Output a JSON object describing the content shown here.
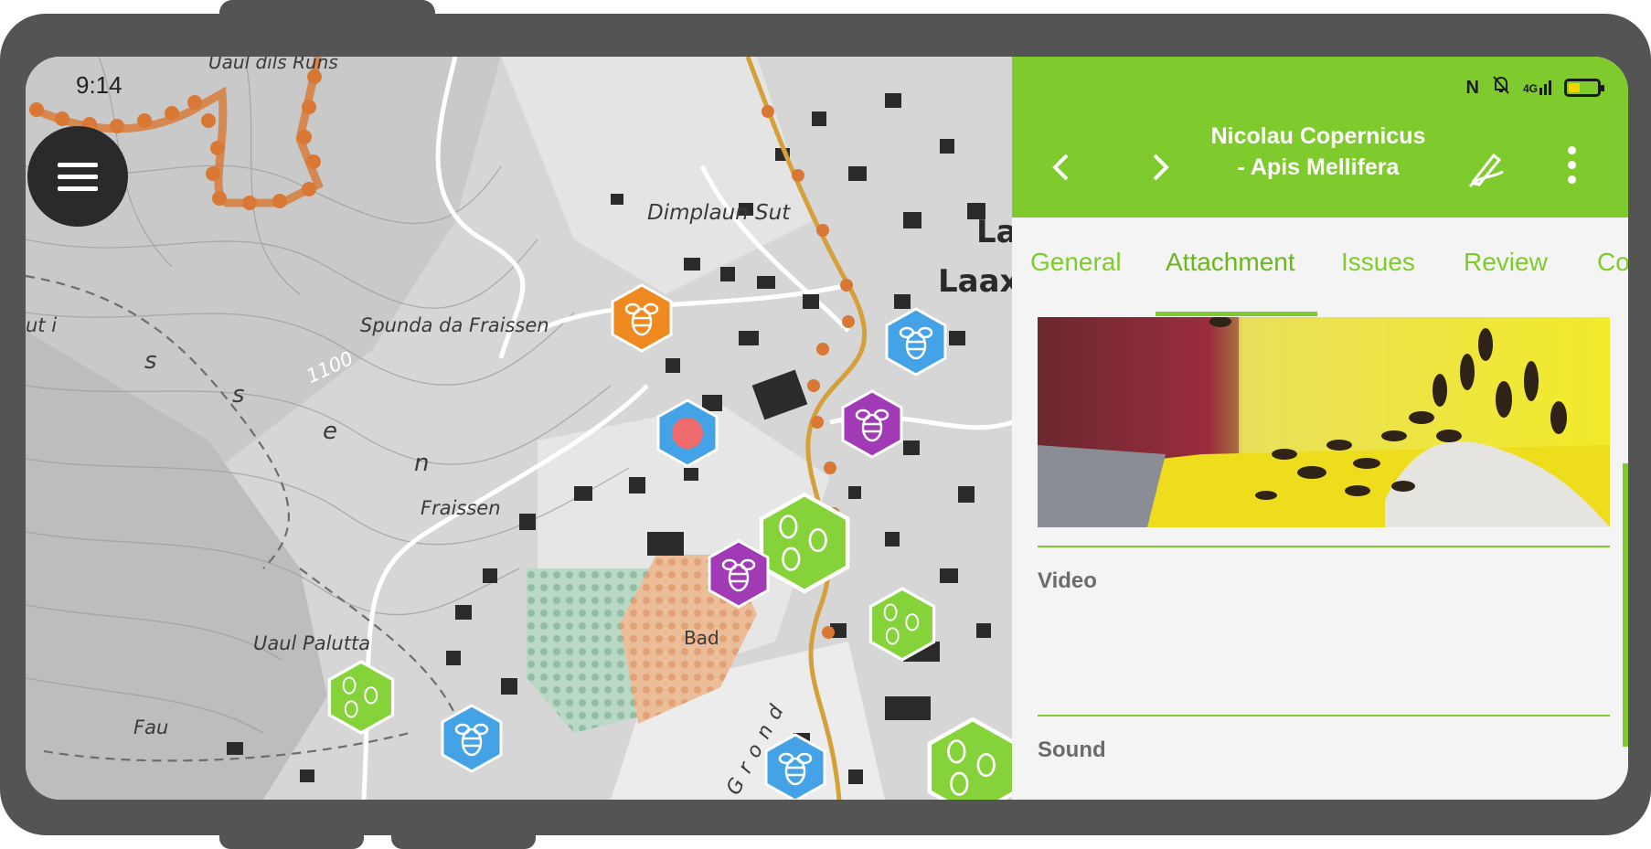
{
  "status_bar": {
    "time": "9:14",
    "network_label": "4G",
    "icons": [
      "nfc-icon",
      "bell-off-icon",
      "signal-icon",
      "battery-icon"
    ]
  },
  "map": {
    "labels": [
      {
        "id": "uaul-dils-runs",
        "text": "Uaul dils Runs"
      },
      {
        "id": "dimplaun-sut",
        "text": "Dimplaun Sut"
      },
      {
        "id": "spunda-da-fraissen",
        "text": "Spunda da Fraissen"
      },
      {
        "id": "laax",
        "text": "Laax"
      },
      {
        "id": "la",
        "text": "La"
      },
      {
        "id": "fraissen",
        "text": "Fraissen"
      },
      {
        "id": "uaul-palutta",
        "text": "Uaul Palutta"
      },
      {
        "id": "fau",
        "text": "Fau"
      },
      {
        "id": "bad",
        "text": "Bad"
      },
      {
        "id": "grond",
        "text": "Grond"
      },
      {
        "id": "contour-1100",
        "text": "1100"
      },
      {
        "id": "river-s",
        "text": "s"
      },
      {
        "id": "river-s2",
        "text": "s"
      },
      {
        "id": "river-e",
        "text": "e"
      },
      {
        "id": "river-n",
        "text": "n"
      },
      {
        "id": "ut-i",
        "text": "ut i"
      }
    ],
    "markers": [
      "orange-bee",
      "blue-bee",
      "purple-bee",
      "current-location",
      "green-bee-cluster",
      "purple-bee",
      "green-bee-cluster",
      "green-bee-cluster",
      "blue-bee",
      "blue-bee",
      "green-bee-cluster"
    ],
    "colors": {
      "orange": "#ee8a1f",
      "blue": "#44a3e6",
      "purple": "#a03ab5",
      "green": "#86d23a",
      "location": "#f06b6b",
      "trail": "#d87834"
    }
  },
  "panel": {
    "title": "Nicolau Copernicus - Apis Mellifera",
    "tabs": [
      "General",
      "Attachment",
      "Issues",
      "Review",
      "Co"
    ],
    "active_tab": "Attachment",
    "fields": {
      "video_label": "Video",
      "sound_label": "Sound"
    },
    "accent_color": "#7fcb2e"
  }
}
